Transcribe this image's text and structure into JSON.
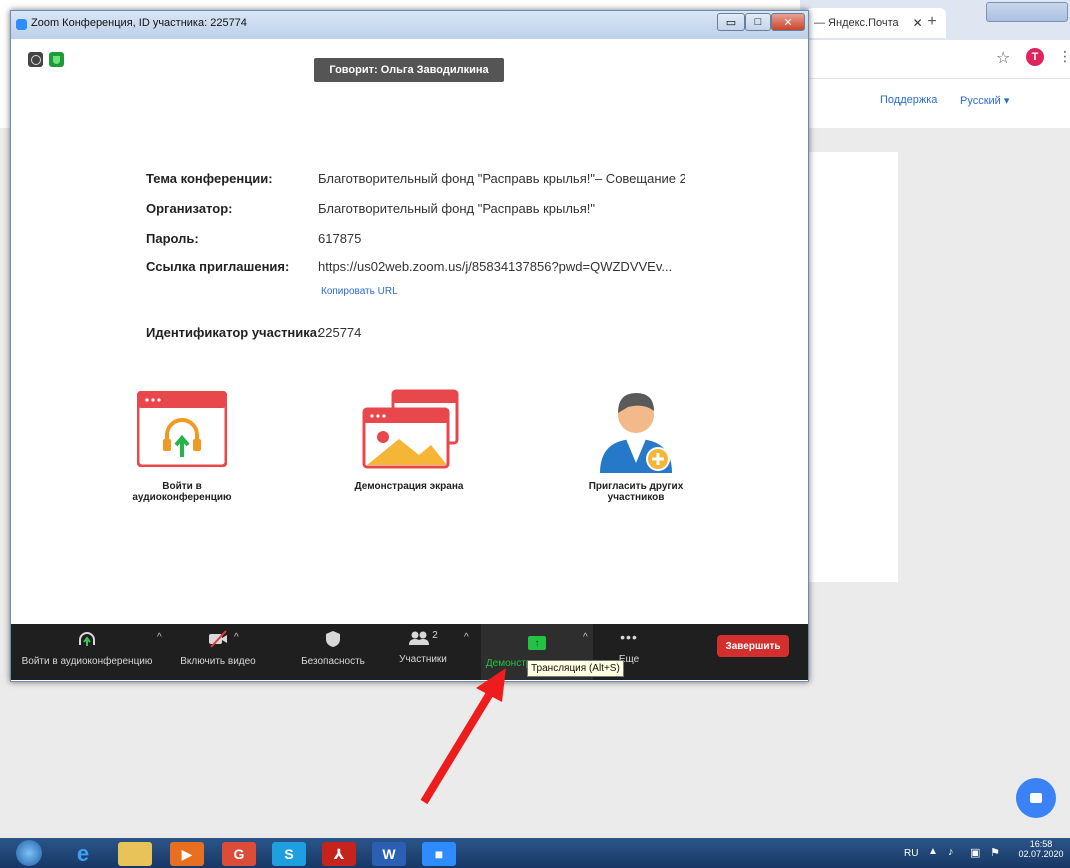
{
  "zoom": {
    "title": "Zoom Конференция, ID участника: 225774",
    "speaker": "Говорит: Ольга Заводилкина",
    "info": {
      "topic_label": "Тема конференции:",
      "topic_value": "Благотворительный фонд \"Расправь крылья!\"– Совещание 2",
      "host_label": "Организатор:",
      "host_value": "Благотворительный фонд \"Расправь крылья!\"",
      "password_label": "Пароль:",
      "password_value": "617875",
      "link_label": "Ссылка приглашения:",
      "link_value": "https://us02web.zoom.us/j/85834137856?pwd=QWZDVVEv...",
      "copy_url": "Копировать URL",
      "participant_id_label": "Идентификатор участника:",
      "participant_id_value": "225774"
    },
    "actions": {
      "audio_line1": "Войти в",
      "audio_line2": "аудиоконференцию",
      "share": "Демонстрация экрана",
      "invite_line1": "Пригласить других",
      "invite_line2": "участников"
    },
    "toolbar": {
      "audio": "Войти в аудиоконференцию",
      "video": "Включить видео",
      "security": "Безопасность",
      "participants": "Участники",
      "participants_count": "2",
      "share": "Демонстрация экрана",
      "more": "Еще",
      "end": "Завершить",
      "tooltip": "Трансляция (Alt+S)"
    }
  },
  "browser": {
    "tab_title": "— Яндекс.Почта",
    "avatar_letter": "T",
    "support_link": "Поддержка",
    "language": "Русский"
  },
  "taskbar": {
    "lang": "RU",
    "time": "16:58",
    "date": "02.07.2020"
  },
  "colors": {
    "accent_red": "#e8474c",
    "toolbar_bg": "#1f1f1f",
    "share_green": "#23c244",
    "end_button": "#d32f2f",
    "link_blue": "#2d6bcf"
  }
}
